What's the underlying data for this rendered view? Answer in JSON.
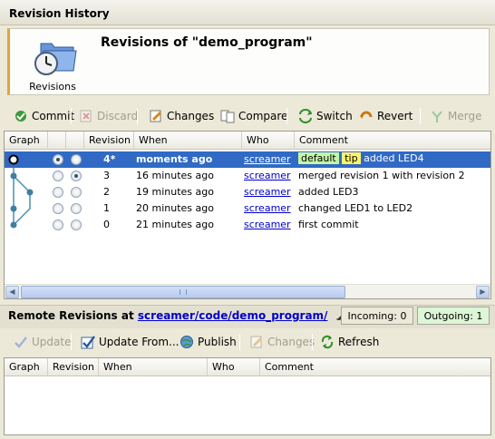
{
  "window_title": "Revision History",
  "header": {
    "icon_label": "Revisions",
    "title": "Revisions of \"demo_program\""
  },
  "toolbar": {
    "commit": "Commit",
    "discard": "Discard",
    "changes": "Changes",
    "compare": "Compare",
    "switch": "Switch",
    "revert": "Revert",
    "merge": "Merge"
  },
  "revisions": {
    "columns": {
      "graph": "Graph",
      "revision": "Revision",
      "when": "When",
      "who": "Who",
      "comment": "Comment"
    },
    "rows": [
      {
        "revision": "4*",
        "when": "moments ago",
        "who": "screamer",
        "tags": [
          "default",
          "tip"
        ],
        "comment": "added LED4"
      },
      {
        "revision": "3",
        "when": "16 minutes ago",
        "who": "screamer",
        "tags": [],
        "comment": "merged revision 1 with revision 2"
      },
      {
        "revision": "2",
        "when": "19 minutes ago",
        "who": "screamer",
        "tags": [],
        "comment": "added LED3"
      },
      {
        "revision": "1",
        "when": "20 minutes ago",
        "who": "screamer",
        "tags": [],
        "comment": "changed LED1 to LED2"
      },
      {
        "revision": "0",
        "when": "21 minutes ago",
        "who": "screamer",
        "tags": [],
        "comment": "first commit"
      }
    ]
  },
  "remote": {
    "label_prefix": "Remote Revisions at",
    "path": "screamer/code/demo_program/",
    "incoming": "Incoming: 0",
    "outgoing": "Outgoing: 1"
  },
  "remote_toolbar": {
    "update": "Update",
    "update_from": "Update From...",
    "publish": "Publish",
    "changes": "Changes",
    "refresh": "Refresh"
  },
  "remote_columns": {
    "graph": "Graph",
    "revision": "Revision",
    "when": "When",
    "who": "Who",
    "comment": "Comment"
  },
  "colors": {
    "selection": "#316ac5",
    "tag_default": "#c3f6a6",
    "tag_tip": "#fff36a",
    "accent": "#e5a23a"
  }
}
